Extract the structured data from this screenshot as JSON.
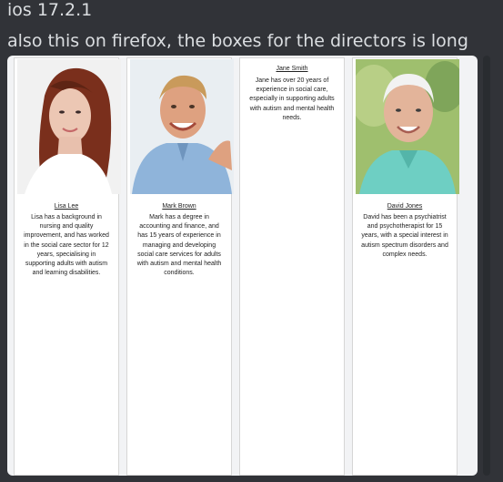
{
  "message": {
    "line1": "ios 17.2.1",
    "line2": "also this on firefox, the boxes for the directors is long"
  },
  "directors": [
    {
      "name": "Lisa Lee",
      "photo": "woman-portrait",
      "bio": "Lisa has a background in nursing and quality improvement, and has worked in the social care sector for 12 years, specialising in supporting adults with autism and learning disabilities."
    },
    {
      "name": "Mark Brown",
      "photo": "man-blue-shirt-portrait",
      "bio": "Mark has a degree in accounting and finance, and has 15 years of experience in managing and developing social care services for adults with autism and mental health conditions."
    },
    {
      "name": "Jane Smith",
      "photo": "",
      "bio": "Jane has over 20 years of experience in social care, especially in supporting adults with autism and mental health needs."
    },
    {
      "name": "David Jones",
      "photo": "older-man-portrait",
      "bio": "David has been a psychiatrist and psychotherapist for 15 years, with a special interest in autism spectrum disorders and complex needs."
    }
  ]
}
